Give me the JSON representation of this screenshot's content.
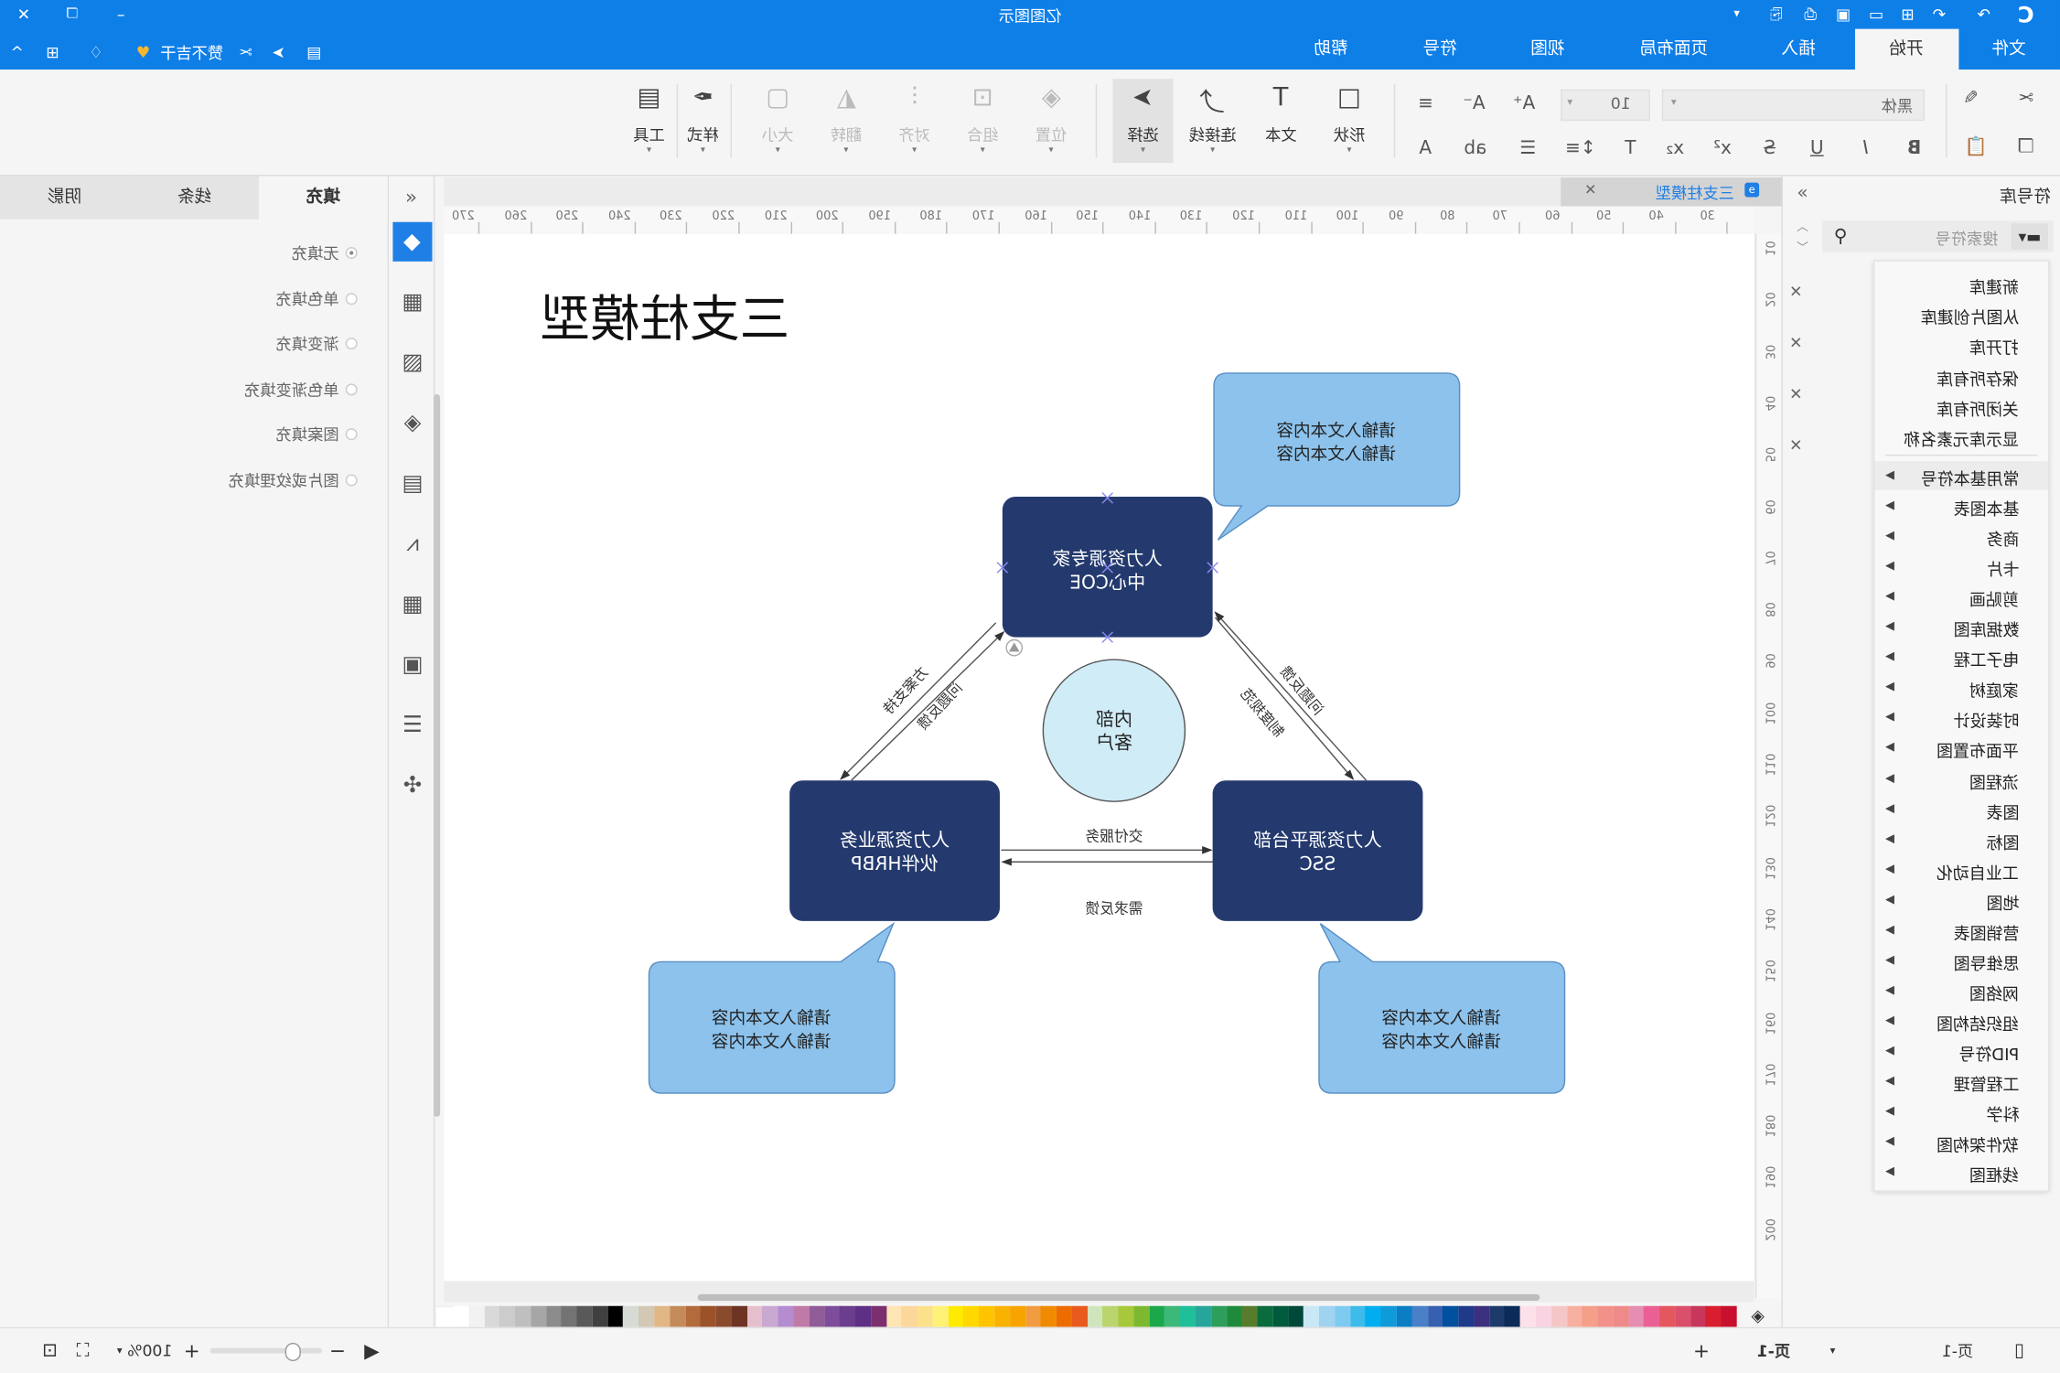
{
  "app": {
    "title": "亿图图示",
    "user_label": "赞不吉干",
    "accent": "#0f7fe8"
  },
  "menu_tabs": [
    {
      "label": "文件"
    },
    {
      "label": "开始",
      "active": true
    },
    {
      "label": "插入"
    },
    {
      "label": "页面布局"
    },
    {
      "label": "视图"
    },
    {
      "label": "符号"
    },
    {
      "label": "帮助"
    }
  ],
  "toolbar": {
    "font_family": "黑体",
    "font_size": "10",
    "buttons": [
      {
        "label": "形状",
        "icon": "rectangle-icon"
      },
      {
        "label": "文本",
        "icon": "text-icon"
      },
      {
        "label": "连接线",
        "icon": "connector-icon"
      },
      {
        "label": "选择",
        "icon": "pointer-icon",
        "active": true
      },
      {
        "label": "位置",
        "icon": "layers-icon",
        "disabled": true
      },
      {
        "label": "组合",
        "icon": "group-icon",
        "disabled": true
      },
      {
        "label": "对齐",
        "icon": "align-icon",
        "disabled": true
      },
      {
        "label": "翻转",
        "icon": "flip-icon",
        "disabled": true
      },
      {
        "label": "大小",
        "icon": "size-icon",
        "disabled": true
      },
      {
        "label": "样式",
        "icon": "style-icon"
      },
      {
        "label": "工具",
        "icon": "tools-icon"
      }
    ]
  },
  "left_panel": {
    "tabs": [
      {
        "label": "填充",
        "active": true
      },
      {
        "label": "线条"
      },
      {
        "label": "阴影"
      }
    ],
    "fill_options": [
      {
        "label": "无填充",
        "checked": true
      },
      {
        "label": "单色填充"
      },
      {
        "label": "渐变填充"
      },
      {
        "label": "单色渐变填充"
      },
      {
        "label": "图案填充"
      },
      {
        "label": "图片或纹理填充"
      }
    ]
  },
  "document": {
    "tab_label": "三支柱模型"
  },
  "rulers": {
    "top": [
      "270",
      "260",
      "250",
      "240",
      "230",
      "220",
      "210",
      "200",
      "190",
      "180",
      "170",
      "160",
      "150",
      "140",
      "130",
      "120",
      "110",
      "100",
      "90",
      "80",
      "70",
      "60",
      "50",
      "40",
      "30"
    ],
    "left": [
      "10",
      "20",
      "30",
      "40",
      "50",
      "60",
      "70",
      "80",
      "90",
      "100",
      "110",
      "120",
      "130",
      "140",
      "150",
      "160",
      "170",
      "180",
      "190",
      "200"
    ]
  },
  "diagram": {
    "title": "三支柱模型",
    "coe": [
      "人力资源专家",
      "中心COE"
    ],
    "hrbp": [
      "人力资源业务",
      "伙伴HRBP"
    ],
    "ssc": [
      "人力资源平台部",
      "SSC"
    ],
    "center": [
      "内部",
      "客户"
    ],
    "callout_text": [
      "请输入文本内容",
      "请输入文本内容"
    ],
    "edge_labels": {
      "coe_hrbp_a": "方案支持",
      "coe_hrbp_b": "问题反馈",
      "coe_ssc_a": "问题反馈",
      "coe_ssc_b": "制度规范",
      "hrbp_ssc_a": "交付服务",
      "hrbp_ssc_b": "需求反馈"
    },
    "colors": {
      "box": "#243a6e",
      "callout": "#8cc2ec",
      "center": "#d0ecf6"
    }
  },
  "library": {
    "title": "符号库",
    "search_placeholder": "搜索符号",
    "actions": [
      "新建库",
      "从图片创建库",
      "打开库",
      "保存所有库",
      "关闭所有库",
      "显示库元素名称"
    ],
    "categories": [
      "常用基本符号",
      "基本图表",
      "商务",
      "卡片",
      "剪贴画",
      "数据库图",
      "电子工程",
      "家庭树",
      "时装设计",
      "平面布置图",
      "流程图",
      "图表",
      "图标",
      "工业自动化",
      "地图",
      "营销图表",
      "思维导图",
      "网络图",
      "组织结构图",
      "PID符号",
      "工程管理",
      "科学",
      "软件架构图",
      "线框图"
    ]
  },
  "palette": [
    "#ffffff",
    "#f2f2f2",
    "#d9d9d9",
    "#cccccc",
    "#bfbfbf",
    "#a6a6a6",
    "#8c8c8c",
    "#737373",
    "#595959",
    "#404040",
    "#000000",
    "#d6dcd5",
    "#d3c8b4",
    "#e0b785",
    "#c58a5a",
    "#b36b3c",
    "#9b5228",
    "#8a4a2e",
    "#6e3423",
    "#e6bfcc",
    "#c9a8d2",
    "#b48ccf",
    "#c07aa8",
    "#8f5c98",
    "#7d4d9c",
    "#6a3d8e",
    "#5e2f85",
    "#7c2f6e",
    "#ffe5b4",
    "#fcd79a",
    "#fce18a",
    "#fff176",
    "#ffeb00",
    "#ffd800",
    "#ffc400",
    "#f9b200",
    "#f7a400",
    "#f29c41",
    "#f08a00",
    "#ec6c00",
    "#e85a1e",
    "#cfe6bd",
    "#bad56e",
    "#a7c83b",
    "#7cb930",
    "#1aa84a",
    "#3cb878",
    "#1fbf9a",
    "#26a69a",
    "#2e9e5b",
    "#1f8a3c",
    "#577d2c",
    "#0a6b3c",
    "#005a3c",
    "#00483a",
    "#c9e8f6",
    "#9fd3f0",
    "#7ecbf2",
    "#3dbbeb",
    "#00aeef",
    "#0f9ad9",
    "#0a7dc5",
    "#4a80c8",
    "#3660b0",
    "#0050a0",
    "#1e3a8a",
    "#3b2f7e",
    "#1c3b6b",
    "#0d2b59",
    "#fde1ea",
    "#f9d3e1",
    "#f5c6c6",
    "#f7b0a0",
    "#f59f8a",
    "#f29189",
    "#ef8a8a",
    "#e58db2",
    "#ea6095",
    "#e5575f",
    "#d94f6c",
    "#c8375b",
    "#d81e2f",
    "#c8102e"
  ],
  "status": {
    "zoom": "100%",
    "zoom_level_percent": 100,
    "page_tab": "页-1",
    "page_selector": "页-1"
  }
}
